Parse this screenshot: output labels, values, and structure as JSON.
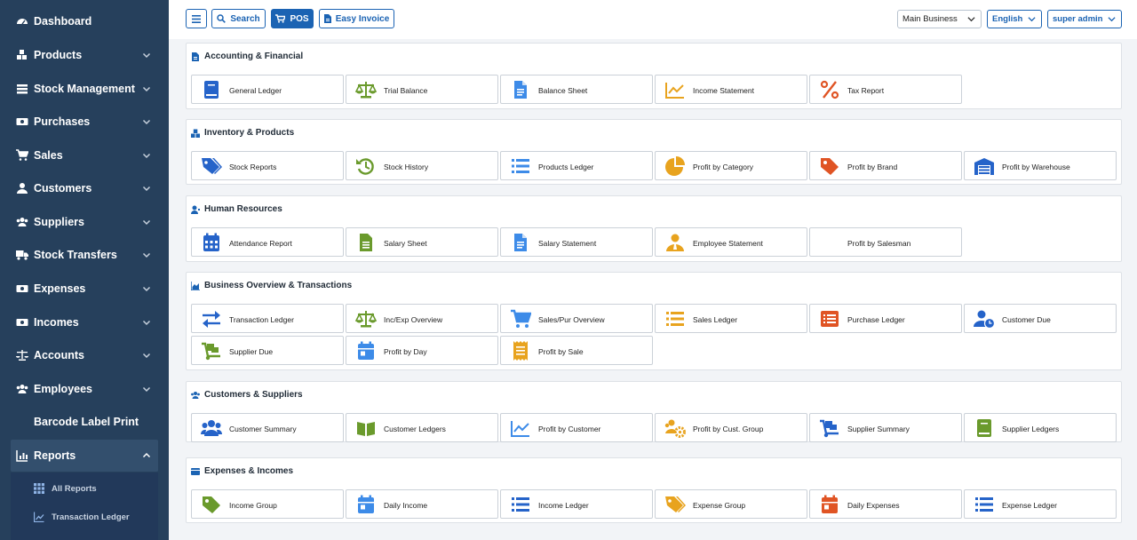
{
  "sidebar": {
    "items": [
      {
        "label": "Dashboard",
        "icon": "dashboard-icon"
      },
      {
        "label": "Products",
        "icon": "products-icon"
      },
      {
        "label": "Stock Management",
        "icon": "stock-icon"
      },
      {
        "label": "Purchases",
        "icon": "purchases-icon"
      },
      {
        "label": "Sales",
        "icon": "cart-icon"
      },
      {
        "label": "Customers",
        "icon": "user-icon"
      },
      {
        "label": "Suppliers",
        "icon": "users-icon"
      },
      {
        "label": "Stock Transfers",
        "icon": "truck-icon"
      },
      {
        "label": "Expenses",
        "icon": "money-icon"
      },
      {
        "label": "Incomes",
        "icon": "money-icon"
      },
      {
        "label": "Accounts",
        "icon": "scale-icon"
      },
      {
        "label": "Employees",
        "icon": "users-icon"
      },
      {
        "label": "Barcode Label Print",
        "icon": ""
      },
      {
        "label": "Reports",
        "icon": "chart-icon"
      }
    ],
    "sub_items": [
      {
        "label": "All Reports",
        "icon": "grid-icon"
      },
      {
        "label": "Transaction Ledger",
        "icon": "chart-line-icon"
      }
    ]
  },
  "topbar": {
    "menu_icon": "hamburger-icon",
    "search_label": "Search",
    "pos_label": "POS",
    "invoice_label": "Easy Invoice",
    "business": "Main Business",
    "language": "English",
    "user": "super admin"
  },
  "colors": {
    "sidebar": "#26405c",
    "accent": "#1b63b3",
    "blue": "#2563c9",
    "green": "#6a9a2c",
    "orange": "#e8a31e",
    "red": "#e05424"
  },
  "sections": [
    {
      "title": "Accounting & Financial",
      "icon": "file-icon",
      "cards": [
        {
          "label": "General Ledger",
          "icon": "book-icon",
          "color": "#2563c9"
        },
        {
          "label": "Trial Balance",
          "icon": "scale-icon",
          "color": "#6a9a2c"
        },
        {
          "label": "Balance Sheet",
          "icon": "document-icon",
          "color": "#3d8be8"
        },
        {
          "label": "Income Statement",
          "icon": "chart-line-icon",
          "color": "#e8a31e"
        },
        {
          "label": "Tax Report",
          "icon": "percent-icon",
          "color": "#e05424"
        }
      ]
    },
    {
      "title": "Inventory & Products",
      "icon": "boxes-icon",
      "cards": [
        {
          "label": "Stock Reports",
          "icon": "tags-icon",
          "color": "#2563c9"
        },
        {
          "label": "Stock History",
          "icon": "history-icon",
          "color": "#6a9a2c"
        },
        {
          "label": "Products Ledger",
          "icon": "list-icon",
          "color": "#3d8be8"
        },
        {
          "label": "Profit by Category",
          "icon": "pie-icon",
          "color": "#e8a31e"
        },
        {
          "label": "Profit by Brand",
          "icon": "tag-icon",
          "color": "#e05424"
        },
        {
          "label": "Profit by Warehouse",
          "icon": "warehouse-icon",
          "color": "#2563c9"
        }
      ]
    },
    {
      "title": "Human Resources",
      "icon": "user-icon",
      "cards": [
        {
          "label": "Attendance Report",
          "icon": "calendar-icon",
          "color": "#2563c9"
        },
        {
          "label": "Salary Sheet",
          "icon": "sheet-icon",
          "color": "#6a9a2c"
        },
        {
          "label": "Salary Statement",
          "icon": "document-icon",
          "color": "#3d8be8"
        },
        {
          "label": "Employee Statement",
          "icon": "employee-icon",
          "color": "#e8a31e"
        },
        {
          "label": "Profit by Salesman",
          "icon": "",
          "color": "#e05424"
        }
      ]
    },
    {
      "title": "Business Overview & Transactions",
      "icon": "chart-area-icon",
      "cards": [
        {
          "label": "Transaction Ledger",
          "icon": "exchange-icon",
          "color": "#2563c9"
        },
        {
          "label": "Inc/Exp Overview",
          "icon": "scale-icon",
          "color": "#6a9a2c"
        },
        {
          "label": "Sales/Pur Overview",
          "icon": "cart-icon",
          "color": "#3d8be8"
        },
        {
          "label": "Sales Ledger",
          "icon": "list-icon",
          "color": "#e8a31e"
        },
        {
          "label": "Purchase Ledger",
          "icon": "list-alt-icon",
          "color": "#e05424"
        },
        {
          "label": "Customer Due",
          "icon": "user-clock-icon",
          "color": "#2563c9"
        },
        {
          "label": "Supplier Due",
          "icon": "dolly-icon",
          "color": "#6a9a2c"
        },
        {
          "label": "Profit by Day",
          "icon": "calendar-day-icon",
          "color": "#3d8be8"
        },
        {
          "label": "Profit by Sale",
          "icon": "receipt-icon",
          "color": "#e8a31e"
        }
      ]
    },
    {
      "title": "Customers & Suppliers",
      "icon": "users-icon",
      "cards": [
        {
          "label": "Customer Summary",
          "icon": "users-icon",
          "color": "#2563c9"
        },
        {
          "label": "Customer Ledgers",
          "icon": "book-open-icon",
          "color": "#6a9a2c"
        },
        {
          "label": "Profit by Customer",
          "icon": "chart-line-icon",
          "color": "#3d8be8"
        },
        {
          "label": "Profit by Cust. Group",
          "icon": "users-cog-icon",
          "color": "#e8a31e"
        },
        {
          "label": "Supplier Summary",
          "icon": "dolly-icon",
          "color": "#2563c9"
        },
        {
          "label": "Supplier Ledgers",
          "icon": "book-icon",
          "color": "#6a9a2c"
        }
      ]
    },
    {
      "title": "Expenses & Incomes",
      "icon": "wallet-icon",
      "cards": [
        {
          "label": "Income Group",
          "icon": "tag-icon",
          "color": "#6a9a2c"
        },
        {
          "label": "Daily Income",
          "icon": "calendar-day-icon",
          "color": "#3d8be8"
        },
        {
          "label": "Income Ledger",
          "icon": "list-icon",
          "color": "#2563c9"
        },
        {
          "label": "Expense Group",
          "icon": "tags-icon",
          "color": "#e8a31e"
        },
        {
          "label": "Daily Expenses",
          "icon": "calendar-day-icon",
          "color": "#e05424"
        },
        {
          "label": "Expense Ledger",
          "icon": "list-icon",
          "color": "#2563c9"
        }
      ]
    }
  ]
}
